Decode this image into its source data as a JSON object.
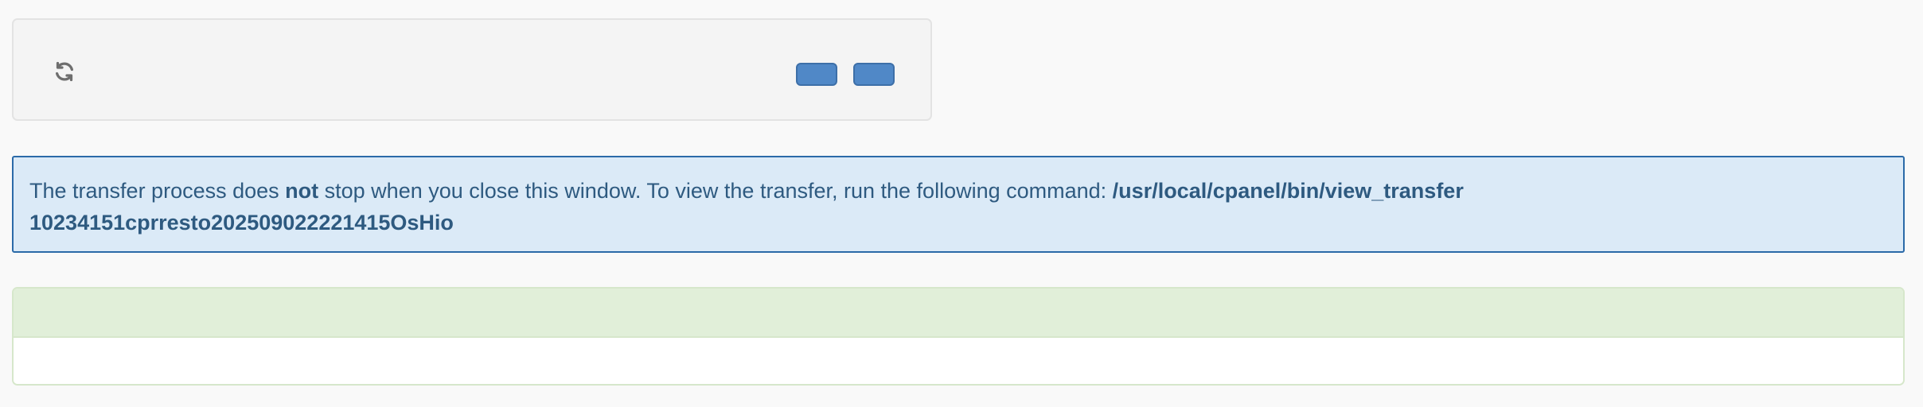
{
  "toolbar": {
    "refresh_icon": "refresh-icon",
    "button_one_label": "",
    "button_two_label": "",
    "button_color": "#5088c7"
  },
  "alert": {
    "text_before_bold": "The transfer process does ",
    "bold_word": "not",
    "text_after_bold": " stop when you close this window. To view the transfer, run the following command: ",
    "command": "/usr/local/cpanel/bin/view_transfer",
    "session_id": "10234151cprresto202509022221415OsHio",
    "background": "#dbeaf7",
    "border_color": "#2b6aa8",
    "text_color": "#2e5a80"
  },
  "log": {
    "header_title": "",
    "body_text": "",
    "header_color": "#e1efd9"
  }
}
